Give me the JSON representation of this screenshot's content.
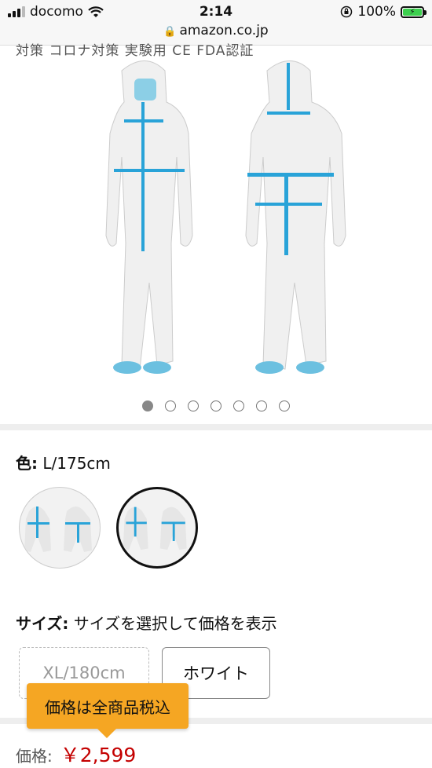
{
  "status_bar": {
    "carrier": "docomo",
    "time": "2:14",
    "battery": "100%"
  },
  "url_bar": {
    "url": "amazon.co.jp"
  },
  "product": {
    "title_fragment": "対策 コロナ対策 実験用 CE FDA認証",
    "image_count": 7,
    "active_image_index": 0
  },
  "color": {
    "label": "色:",
    "value": "L/175cm",
    "swatches": [
      "white-blue-suit-1",
      "white-blue-suit-2"
    ],
    "selected_index": 1
  },
  "size": {
    "label": "サイズ:",
    "hint": "サイズを選択して価格を表示",
    "options": [
      {
        "label": "XL/180cm",
        "available": false
      },
      {
        "label": "ホワイト",
        "available": true
      }
    ]
  },
  "tooltip": {
    "text": "価格は全商品税込"
  },
  "price": {
    "label": "価格:",
    "value": "￥2,599"
  },
  "colors": {
    "price_red": "#c40000",
    "tooltip_orange": "#f5a623",
    "suit_blue": "#29a3d8"
  }
}
